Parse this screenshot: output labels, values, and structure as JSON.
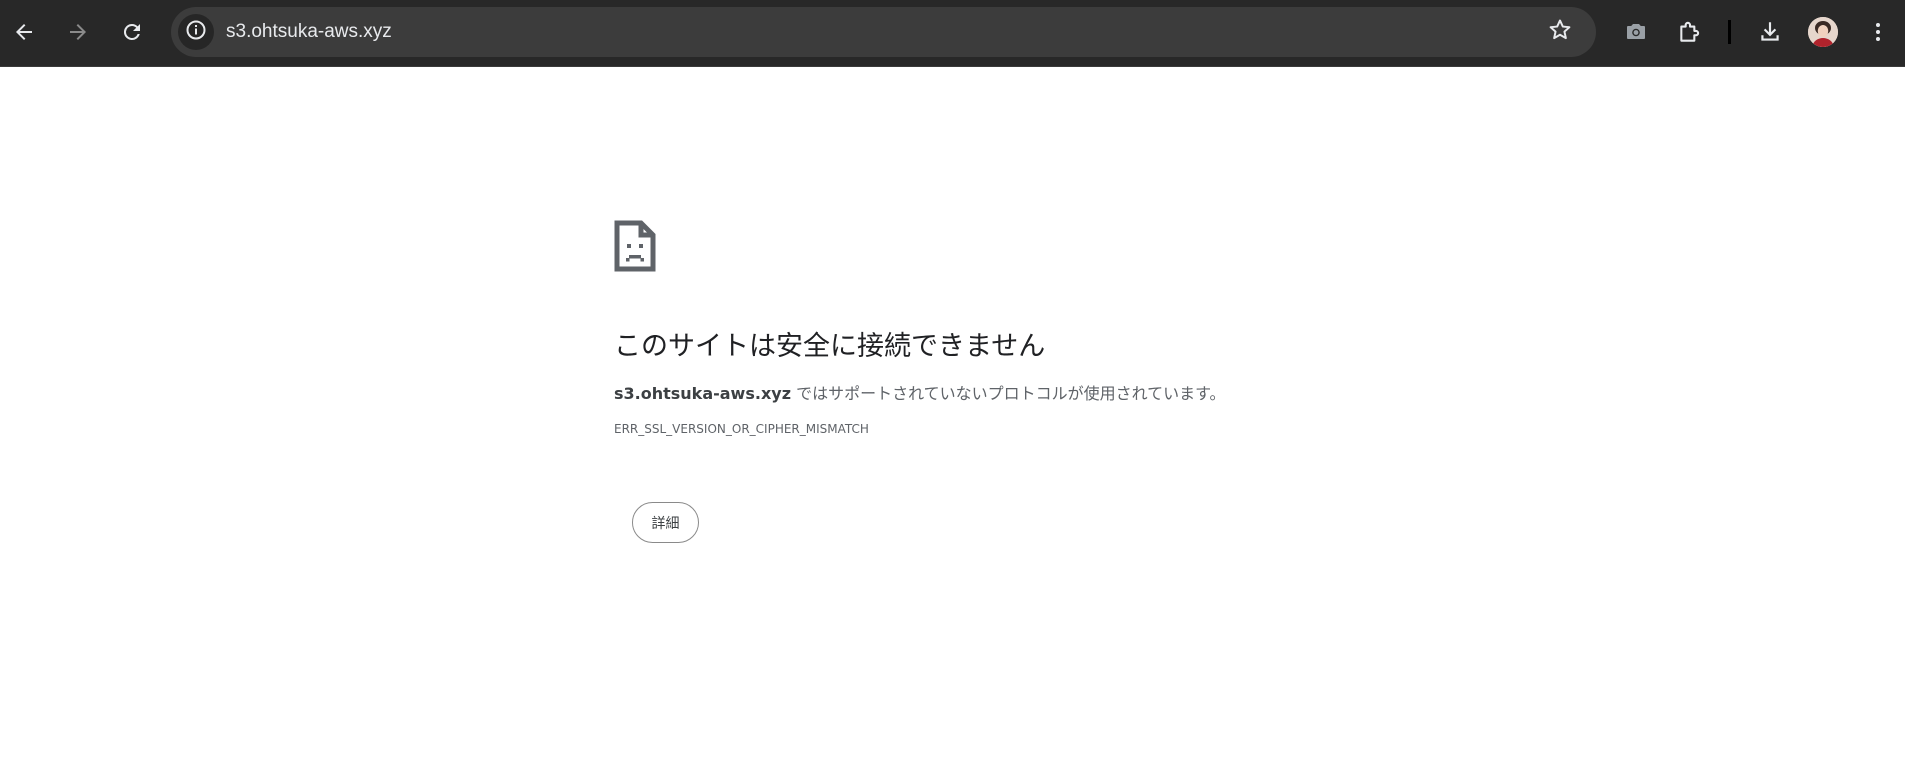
{
  "browser": {
    "url": "s3.ohtsuka-aws.xyz",
    "icons": {
      "back": "arrow-left-icon",
      "forward": "arrow-right-icon",
      "reload": "reload-icon",
      "site_info": "info-icon",
      "bookmark": "star-icon",
      "camera": "camera-icon",
      "extensions": "puzzle-icon",
      "download": "download-icon",
      "profile": "avatar",
      "menu": "kebab-menu-icon"
    },
    "colors": {
      "toolbar_bg": "#282828",
      "omnibox_bg": "#3c3c3c",
      "icon": "#e8eaed",
      "icon_disabled": "#8a8a8a"
    }
  },
  "error_page": {
    "icon": "sad-file-icon",
    "title": "このサイトは安全に接続できません",
    "description_host": "s3.ohtsuka-aws.xyz",
    "description_text": " ではサポートされていないプロトコルが使用されています。",
    "error_code": "ERR_SSL_VERSION_OR_CIPHER_MISMATCH",
    "details_button": "詳細"
  }
}
